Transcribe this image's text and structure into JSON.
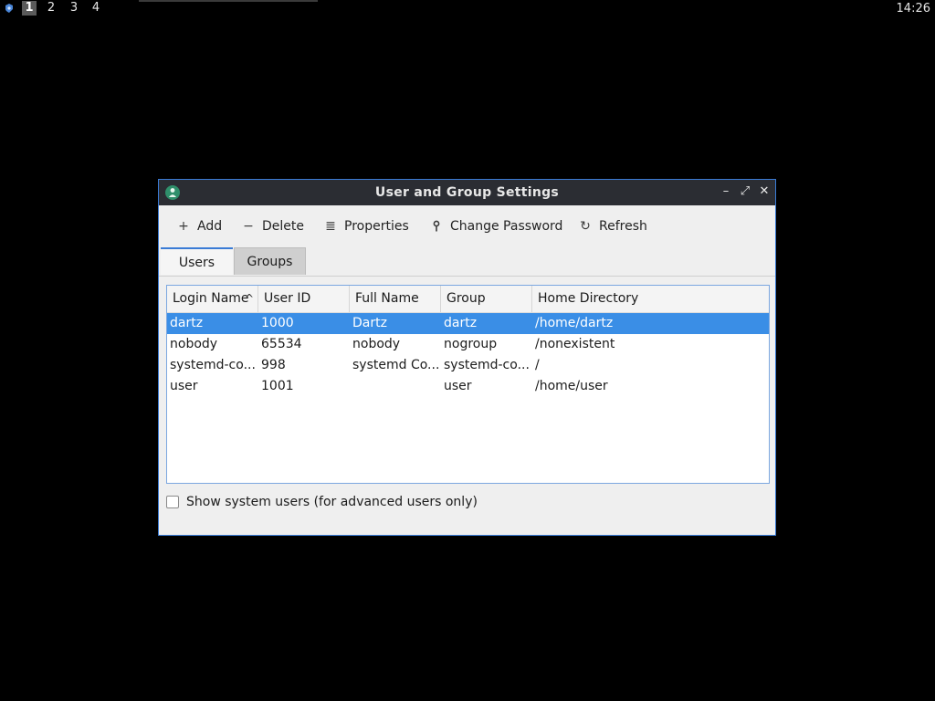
{
  "panel": {
    "workspaces": [
      "1",
      "2",
      "3",
      "4"
    ],
    "active_workspace": "1",
    "clock": "14:26"
  },
  "window": {
    "title": "User and Group Settings",
    "controls": {
      "minimize": "–",
      "maximize": "⤢",
      "close": "✕"
    }
  },
  "toolbar": {
    "add": {
      "label": "Add",
      "icon": "+"
    },
    "delete": {
      "label": "Delete",
      "icon": "−"
    },
    "properties": {
      "label": "Properties",
      "icon": "≣"
    },
    "change_password": {
      "label": "Change Password",
      "icon": "key-icon"
    },
    "refresh": {
      "label": "Refresh",
      "icon": "↻"
    }
  },
  "tabs": [
    {
      "label": "Users",
      "active": true
    },
    {
      "label": "Groups",
      "active": false
    }
  ],
  "table": {
    "columns": [
      "Login Name",
      "User ID",
      "Full Name",
      "Group",
      "Home Directory"
    ],
    "sort_indicator": "^",
    "rows": [
      {
        "login": "dartz",
        "uid": "1000",
        "full_name": "Dartz",
        "group": "dartz",
        "home": "/home/dartz",
        "selected": true
      },
      {
        "login": "nobody",
        "uid": "65534",
        "full_name": "nobody",
        "group": "nogroup",
        "home": "/nonexistent",
        "selected": false
      },
      {
        "login": "systemd-co...",
        "uid": "998",
        "full_name": "systemd Co...",
        "group": "systemd-co...",
        "home": "/",
        "selected": false
      },
      {
        "login": "user",
        "uid": "1001",
        "full_name": "",
        "group": "user",
        "home": "/home/user",
        "selected": false
      }
    ]
  },
  "show_system_users": {
    "label": "Show system users (for advanced users only)",
    "checked": false
  },
  "colors": {
    "accent": "#3a7bd5",
    "selection": "#3a8ee6",
    "titlebar": "#2b2d33"
  }
}
